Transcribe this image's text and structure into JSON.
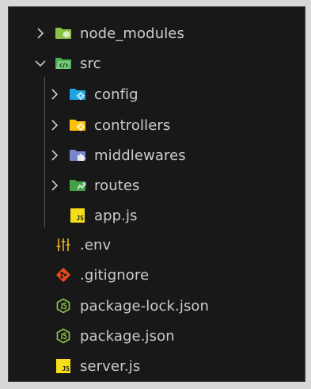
{
  "explorer": {
    "items": [
      {
        "label": "node_modules",
        "type": "folder",
        "expanded": false,
        "depth": 0,
        "icon": "node-folder-icon",
        "color": "#8bc34a"
      },
      {
        "label": "src",
        "type": "folder",
        "expanded": true,
        "depth": 0,
        "icon": "src-folder-icon",
        "color": "#4caf50"
      },
      {
        "label": "config",
        "type": "folder",
        "expanded": false,
        "depth": 1,
        "icon": "config-folder-icon",
        "color": "#20a4e0"
      },
      {
        "label": "controllers",
        "type": "folder",
        "expanded": false,
        "depth": 1,
        "icon": "controllers-folder-icon",
        "color": "#ffc107"
      },
      {
        "label": "middlewares",
        "type": "folder",
        "expanded": false,
        "depth": 1,
        "icon": "middlewares-folder-icon",
        "color": "#7986cb"
      },
      {
        "label": "routes",
        "type": "folder",
        "expanded": false,
        "depth": 1,
        "icon": "routes-folder-icon",
        "color": "#43a047"
      },
      {
        "label": "app.js",
        "type": "file",
        "depth": 1,
        "icon": "javascript-file-icon",
        "color": "#f5de19"
      },
      {
        "label": ".env",
        "type": "file",
        "depth": 0,
        "icon": "env-file-icon",
        "color": "#e6b422"
      },
      {
        "label": ".gitignore",
        "type": "file",
        "depth": 0,
        "icon": "git-file-icon",
        "color": "#e64a19"
      },
      {
        "label": "package-lock.json",
        "type": "file",
        "depth": 0,
        "icon": "nodejs-file-icon",
        "color": "#8bc34a"
      },
      {
        "label": "package.json",
        "type": "file",
        "depth": 0,
        "icon": "nodejs-file-icon",
        "color": "#8bc34a"
      },
      {
        "label": "server.js",
        "type": "file",
        "depth": 0,
        "icon": "javascript-file-icon",
        "color": "#f5de19"
      }
    ],
    "js_badge_text": "JS"
  }
}
